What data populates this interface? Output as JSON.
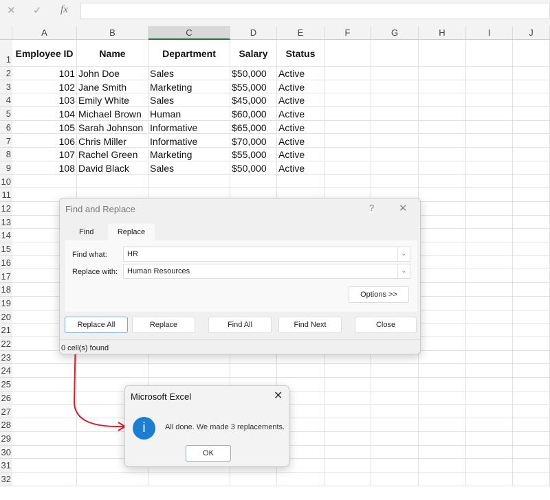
{
  "formula_bar": {
    "cancel_icon": "✕",
    "enter_icon": "✓",
    "fx_icon": "fx",
    "value": ""
  },
  "columns": [
    "A",
    "B",
    "C",
    "D",
    "E",
    "F",
    "G",
    "H",
    "I",
    "J"
  ],
  "selected_column": "C",
  "rows": [
    "1",
    "2",
    "3",
    "4",
    "5",
    "6",
    "7",
    "8",
    "9",
    "10",
    "11",
    "12",
    "13",
    "14",
    "15",
    "16",
    "17",
    "18",
    "19",
    "20",
    "21",
    "22",
    "23",
    "24",
    "25",
    "26",
    "27",
    "28",
    "29",
    "30",
    "31",
    "32"
  ],
  "table": {
    "headers": [
      "Employee ID",
      "Name",
      "Department",
      "Salary",
      "Status"
    ],
    "rows": [
      [
        "101",
        "John Doe",
        "Sales",
        "$50,000",
        "Active"
      ],
      [
        "102",
        "Jane Smith",
        "Marketing",
        "$55,000",
        "Active"
      ],
      [
        "103",
        "Emily White",
        "Sales",
        "$45,000",
        "Active"
      ],
      [
        "104",
        "Michael Brown",
        "Human",
        "$60,000",
        "Active"
      ],
      [
        "105",
        "Sarah Johnson",
        "Informative",
        "$65,000",
        "Active"
      ],
      [
        "106",
        "Chris Miller",
        "Informative",
        "$70,000",
        "Active"
      ],
      [
        "107",
        "Rachel Green",
        "Marketing",
        "$55,000",
        "Active"
      ],
      [
        "108",
        "David Black",
        "Sales",
        "$50,000",
        "Active"
      ]
    ]
  },
  "find_replace": {
    "title": "Find and Replace",
    "help": "?",
    "close_icon": "✕",
    "tabs": [
      "Find",
      "Replace"
    ],
    "active_tab": "Replace",
    "find_label": "Find what:",
    "find_value": "HR",
    "replace_label": "Replace with:",
    "replace_value": "Human Resources",
    "options": "Options >>",
    "buttons": [
      "Replace All",
      "Replace",
      "Find All",
      "Find Next",
      "Close"
    ],
    "status": "0 cell(s) found"
  },
  "message_box": {
    "title": "Microsoft Excel",
    "close_icon": "✕",
    "icon": "i",
    "message": "All done. We made 3 replacements.",
    "ok": "OK"
  },
  "colors": {
    "annotation": "#d0202a",
    "info": "#1a7fd4",
    "excel_green": "#217346"
  }
}
